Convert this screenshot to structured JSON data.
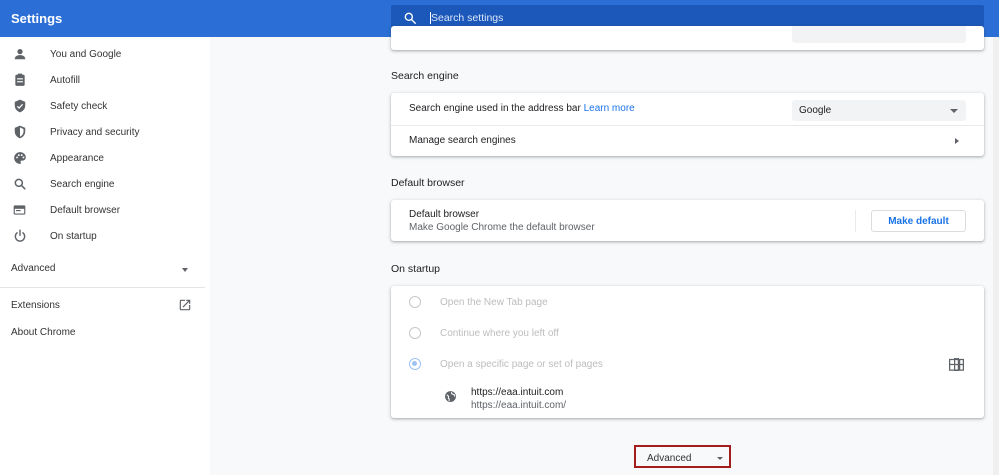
{
  "header": {
    "title": "Settings",
    "search_placeholder": "Search settings"
  },
  "sidebar": {
    "items": [
      {
        "label": "You and Google",
        "icon": "person-icon"
      },
      {
        "label": "Autofill",
        "icon": "clipboard-icon"
      },
      {
        "label": "Safety check",
        "icon": "shield-check-icon"
      },
      {
        "label": "Privacy and security",
        "icon": "shield-icon"
      },
      {
        "label": "Appearance",
        "icon": "palette-icon"
      },
      {
        "label": "Search engine",
        "icon": "search-icon"
      },
      {
        "label": "Default browser",
        "icon": "browser-icon"
      },
      {
        "label": "On startup",
        "icon": "power-icon"
      }
    ],
    "advanced_label": "Advanced",
    "extensions_label": "Extensions",
    "about_label": "About Chrome"
  },
  "search_engine": {
    "title": "Search engine",
    "used_label": "Search engine used in the address bar",
    "learn_more": "Learn more",
    "selected": "Google",
    "manage_label": "Manage search engines"
  },
  "default_browser": {
    "title": "Default browser",
    "heading": "Default browser",
    "description": "Make Google Chrome the default browser",
    "button": "Make default"
  },
  "on_startup": {
    "title": "On startup",
    "options": [
      {
        "label": "Open the New Tab page",
        "checked": false
      },
      {
        "label": "Continue where you left off",
        "checked": false
      },
      {
        "label": "Open a specific page or set of pages",
        "checked": true
      }
    ],
    "page_title": "https://eaa.intuit.com",
    "page_url": "https://eaa.intuit.com/"
  },
  "footer": {
    "advanced_label": "Advanced"
  },
  "colors": {
    "header": "#2b6fd6",
    "accent": "#1a73e8",
    "highlight_box": "#a31d1d"
  }
}
